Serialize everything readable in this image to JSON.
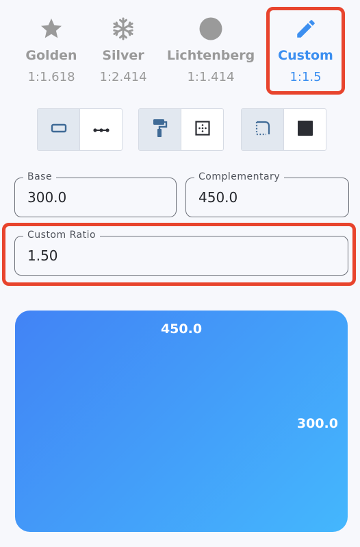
{
  "ratio_tabs": [
    {
      "name": "Golden",
      "ratio": "1:1.618",
      "icon": "star-icon",
      "selected": false
    },
    {
      "name": "Silver",
      "ratio": "1:2.414",
      "icon": "snowflake-icon",
      "selected": false
    },
    {
      "name": "Lichtenberg",
      "ratio": "1:1.414",
      "icon": "circle-icon",
      "selected": false
    },
    {
      "name": "Custom",
      "ratio": "1:1.5",
      "icon": "pencil-icon",
      "selected": true
    }
  ],
  "toggle_groups": [
    {
      "options": [
        {
          "icon": "rectangle-icon",
          "selected": true
        },
        {
          "icon": "line-dots-icon",
          "selected": false
        }
      ]
    },
    {
      "options": [
        {
          "icon": "paint-roller-icon",
          "selected": true
        },
        {
          "icon": "border-inner-icon",
          "selected": false
        }
      ]
    },
    {
      "options": [
        {
          "icon": "border-dashed-corner-icon",
          "selected": true
        },
        {
          "icon": "filled-square-icon",
          "selected": false
        }
      ]
    }
  ],
  "fields": {
    "base": {
      "label": "Base",
      "value": "300.0"
    },
    "complementary": {
      "label": "Complementary",
      "value": "450.0"
    },
    "custom_ratio": {
      "label": "Custom Ratio",
      "value": "1.50"
    }
  },
  "preview": {
    "width_label": "450.0",
    "height_label": "300.0"
  },
  "colors": {
    "accent": "#3c8ff0",
    "highlight": "#e8442d",
    "gradient_start": "#4283f5",
    "gradient_end": "#44b7fd"
  }
}
